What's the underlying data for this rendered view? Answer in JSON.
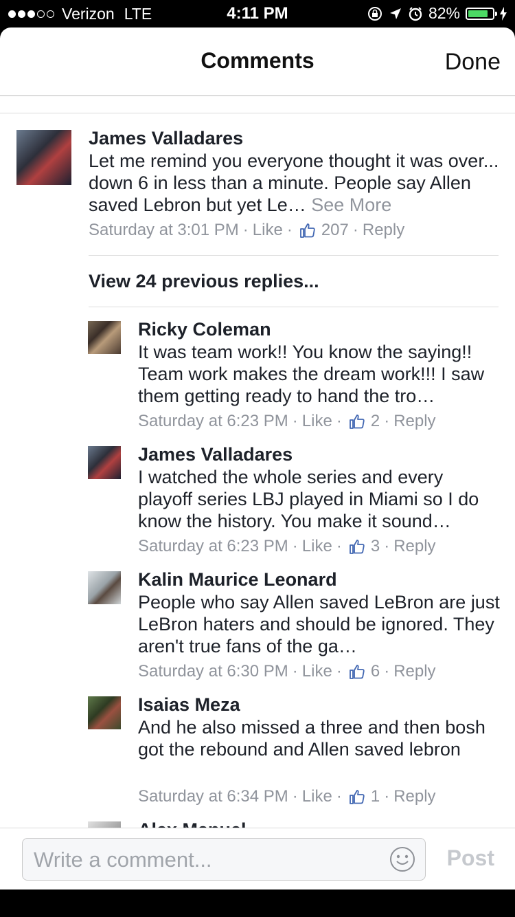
{
  "status_bar": {
    "carrier": "Verizon",
    "network": "LTE",
    "time": "4:11 PM",
    "battery_percent": "82%",
    "battery_level": 0.82,
    "signal_bars_filled": 3,
    "signal_bars_total": 5
  },
  "header": {
    "title": "Comments",
    "done_label": "Done"
  },
  "comments": [
    {
      "author": "James Valladares",
      "text": "Let me remind you everyone thought it was over... down 6 in less than a minute. People say Allen saved Lebron but yet Le…",
      "see_more": "See More",
      "time": "Saturday at 3:01 PM",
      "like": "Like",
      "likes": "207",
      "reply": "Reply"
    }
  ],
  "view_previous": "View 24 previous replies...",
  "replies": [
    {
      "author": "Ricky Coleman",
      "text": "It was team work!! You know the saying!! Team work makes the dream work!!! I saw them getting ready to hand the tro…",
      "time": "Saturday at 6:23 PM",
      "like": "Like",
      "likes": "2",
      "reply": "Reply"
    },
    {
      "author": "James Valladares",
      "text": "I watched the whole series and every playoff series LBJ played in Miami so I do know the history. You make it sound…",
      "time": "Saturday at 6:23 PM",
      "like": "Like",
      "likes": "3",
      "reply": "Reply"
    },
    {
      "author": "Kalin Maurice Leonard",
      "text": "People who say Allen saved LeBron are just LeBron haters and should be ignored. They aren't true fans of the ga…",
      "time": "Saturday at 6:30 PM",
      "like": "Like",
      "likes": "6",
      "reply": "Reply"
    },
    {
      "author": "Isaias Meza",
      "text": "And he also missed a three and then bosh got the rebound and Allen saved lebron",
      "time": "Saturday at 6:34 PM",
      "like": "Like",
      "likes": "1",
      "reply": "Reply"
    },
    {
      "author": "Alex Manuel"
    }
  ],
  "composer": {
    "placeholder": "Write a comment...",
    "post_label": "Post"
  },
  "colors": {
    "text": "#1d2129",
    "meta": "#90949c",
    "like_thumb": "#4267b2",
    "battery": "#4cd964",
    "divider": "#dcdcdc"
  },
  "icons": {
    "like": "thumbs-up-icon",
    "emoji": "smiley-icon",
    "location": "location-arrow-icon",
    "alarm": "alarm-clock-icon",
    "rotation_lock": "rotation-lock-icon",
    "charging": "charging-bolt-icon"
  }
}
